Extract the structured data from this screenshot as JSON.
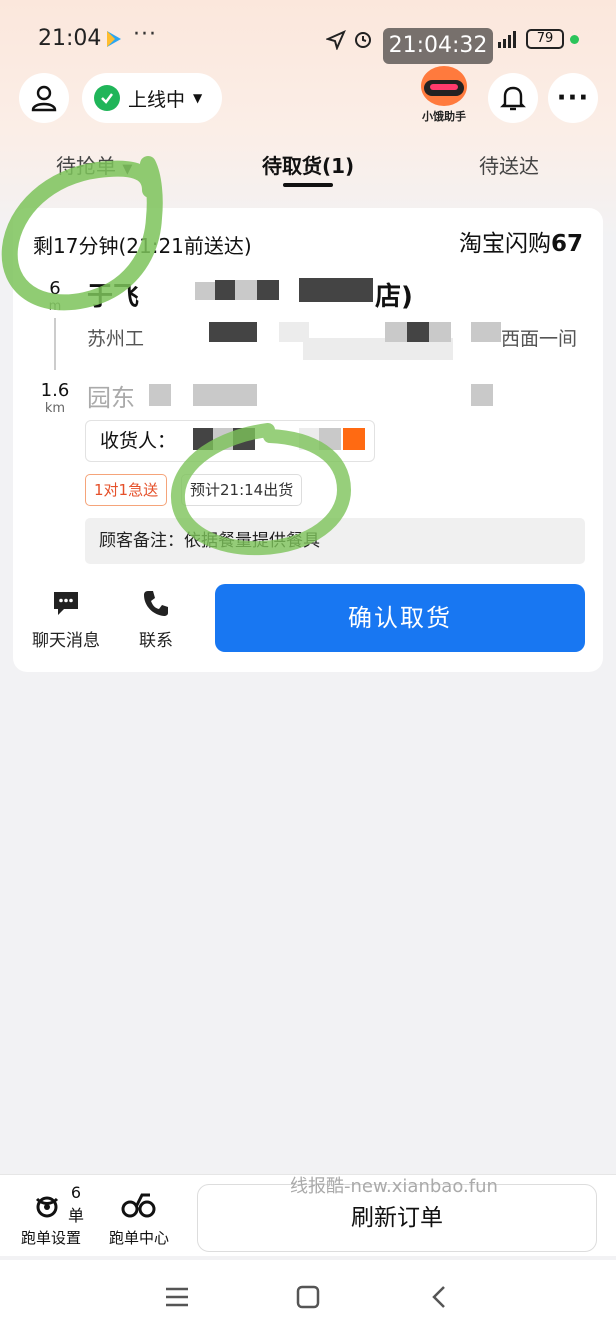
{
  "status_bar": {
    "time": "21:04",
    "dots": "···",
    "overlay_time": "21:04:32",
    "network": "5G",
    "battery": "79"
  },
  "header": {
    "online_status": "上线中",
    "helper_name": "小饿助手"
  },
  "tabs": [
    {
      "label": "待抢单",
      "active": false
    },
    {
      "label": "待取货(1)",
      "active": true
    },
    {
      "label": "待送达",
      "active": false
    }
  ],
  "order": {
    "deadline": "剩17分钟(21:21前送达)",
    "platform_name": "淘宝闪购",
    "platform_no": "67",
    "pickup_distance": "6",
    "pickup_unit": "m",
    "shop_name": "于飞",
    "shop_name_suffix": "店)",
    "shop_address": "苏州工",
    "shop_address_suffix": "西面一间",
    "delivery_distance": "1.6",
    "delivery_unit": "km",
    "customer_address": "园东",
    "receiver_label": "收货人：",
    "tags": [
      "1对1急送",
      "预计21:14出货"
    ],
    "remark": "顾客备注：依据餐量提供餐具",
    "actions": {
      "chat": "聊天消息",
      "contact": "联系",
      "confirm": "确认取货"
    }
  },
  "bottom": {
    "run_settings": "跑单设置",
    "run_settings_badge": "6单",
    "run_center": "跑单中心",
    "refresh": "刷新订单",
    "watermark": "线报酷-new.xianbao.fun"
  },
  "colors": {
    "primary": "#1877f2",
    "online_green": "#20b559",
    "tag_red": "#e5502a",
    "highlight_marks": "#7dc35a"
  }
}
